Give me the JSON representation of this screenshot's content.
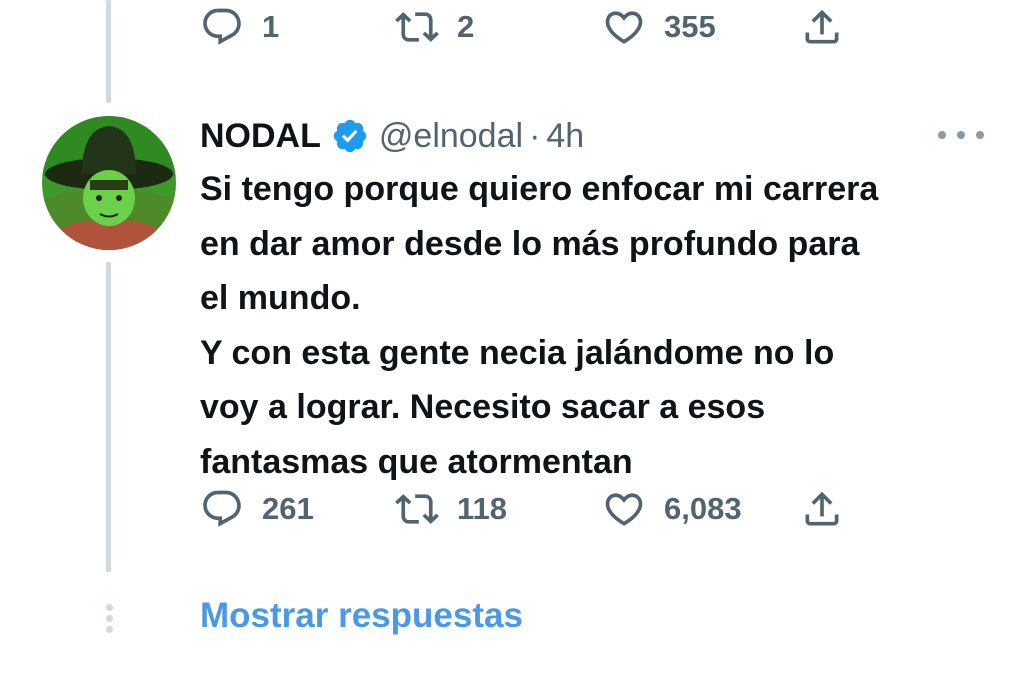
{
  "prev_tweet": {
    "actions": {
      "replies": "1",
      "retweets": "2",
      "likes": "355"
    }
  },
  "tweet": {
    "name": "NODAL",
    "verified": true,
    "handle": "@elnodal",
    "separator": "·",
    "time": "4h",
    "text_lines": [
      "Si tengo porque quiero enfocar mi carrera",
      "en dar amor desde lo más profundo para",
      "el mundo.",
      "Y con esta gente necia jalándome no lo",
      "voy a lograr. Necesito sacar a esos",
      "fantasmas que atormentan"
    ],
    "actions": {
      "replies": "261",
      "retweets": "118",
      "likes": "6,083"
    }
  },
  "show_replies": "Mostrar respuestas",
  "icons": {
    "reply": "reply-icon",
    "retweet": "retweet-icon",
    "like": "heart-icon",
    "share": "share-icon",
    "verified": "verified-badge-icon",
    "more": "more-icon"
  },
  "colors": {
    "text": "#0f1419",
    "secondary": "#536471",
    "link": "#4a99e9",
    "verified": "#1d9bf0",
    "thread_line": "#cfd9de"
  }
}
